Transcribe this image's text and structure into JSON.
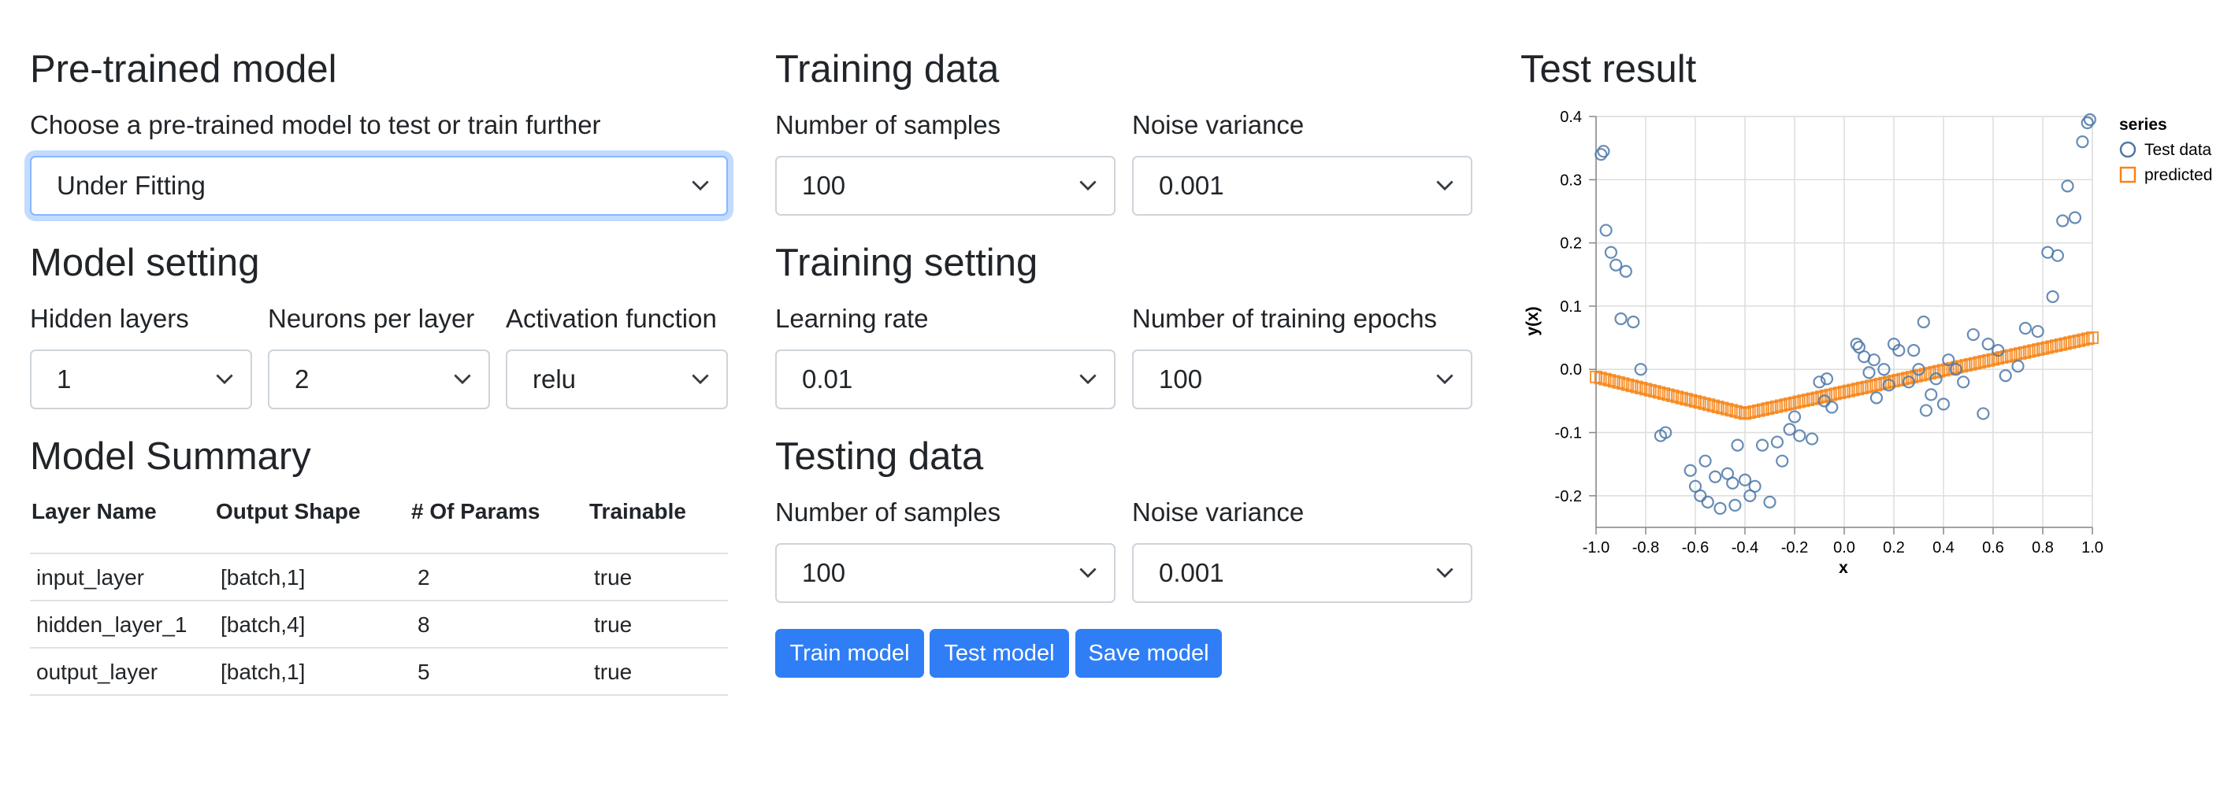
{
  "pretrained": {
    "title": "Pre-trained model",
    "description": "Choose a pre-trained model to test or train further",
    "selected": "Under Fitting"
  },
  "model_setting": {
    "title": "Model setting",
    "hidden_layers_label": "Hidden layers",
    "hidden_layers_value": "1",
    "neurons_label": "Neurons per layer",
    "neurons_value": "2",
    "activation_label": "Activation function",
    "activation_value": "relu"
  },
  "model_summary": {
    "title": "Model Summary",
    "columns": [
      "Layer Name",
      "Output Shape",
      "# Of Params",
      "Trainable"
    ],
    "rows": [
      [
        "input_layer",
        "[batch,1]",
        "2",
        "true"
      ],
      [
        "hidden_layer_1",
        "[batch,4]",
        "8",
        "true"
      ],
      [
        "output_layer",
        "[batch,1]",
        "5",
        "true"
      ]
    ]
  },
  "training_data": {
    "title": "Training data",
    "samples_label": "Number of samples",
    "samples_value": "100",
    "noise_label": "Noise variance",
    "noise_value": "0.001"
  },
  "training_setting": {
    "title": "Training setting",
    "lr_label": "Learning rate",
    "lr_value": "0.01",
    "epochs_label": "Number of training epochs",
    "epochs_value": "100"
  },
  "testing_data": {
    "title": "Testing data",
    "samples_label": "Number of samples",
    "samples_value": "100",
    "noise_label": "Noise variance",
    "noise_value": "0.001"
  },
  "buttons": {
    "train": "Train model",
    "test": "Test model",
    "save": "Save model"
  },
  "test_result": {
    "title": "Test result"
  },
  "chart_data": {
    "type": "scatter",
    "xlabel": "x",
    "ylabel": "y(x)",
    "xlim": [
      -1.0,
      1.0
    ],
    "ylim": [
      -0.25,
      0.4
    ],
    "xticks": [
      -1.0,
      -0.8,
      -0.6,
      -0.4,
      -0.2,
      0.0,
      0.2,
      0.4,
      0.6,
      0.8,
      1.0
    ],
    "xtick_labels": [
      "-1.0",
      "-0.8",
      "-0.6",
      "-0.4",
      "-0.2",
      "0.0",
      "0.2",
      "0.4",
      "0.6",
      "0.8",
      "1.0"
    ],
    "yticks": [
      -0.2,
      -0.1,
      0.0,
      0.1,
      0.2,
      0.3,
      0.4
    ],
    "ytick_labels": [
      "-0.2",
      "-0.1",
      "0.0",
      "0.1",
      "0.2",
      "0.3",
      "0.4"
    ],
    "grid": true,
    "legend_title": "series",
    "legend_position": "right",
    "series": [
      {
        "name": "Test data",
        "marker": "circle",
        "color": "#4c78a8",
        "points": [
          [
            -0.98,
            0.34
          ],
          [
            -0.97,
            0.345
          ],
          [
            -0.96,
            0.22
          ],
          [
            -0.94,
            0.185
          ],
          [
            -0.92,
            0.165
          ],
          [
            -0.88,
            0.155
          ],
          [
            -0.9,
            0.08
          ],
          [
            -0.85,
            0.075
          ],
          [
            -0.82,
            0.0
          ],
          [
            -0.74,
            -0.105
          ],
          [
            -0.72,
            -0.1
          ],
          [
            -0.62,
            -0.16
          ],
          [
            -0.6,
            -0.185
          ],
          [
            -0.58,
            -0.2
          ],
          [
            -0.56,
            -0.145
          ],
          [
            -0.55,
            -0.21
          ],
          [
            -0.52,
            -0.17
          ],
          [
            -0.5,
            -0.22
          ],
          [
            -0.47,
            -0.165
          ],
          [
            -0.45,
            -0.18
          ],
          [
            -0.44,
            -0.215
          ],
          [
            -0.43,
            -0.12
          ],
          [
            -0.4,
            -0.175
          ],
          [
            -0.38,
            -0.2
          ],
          [
            -0.36,
            -0.185
          ],
          [
            -0.33,
            -0.12
          ],
          [
            -0.3,
            -0.21
          ],
          [
            -0.27,
            -0.115
          ],
          [
            -0.25,
            -0.145
          ],
          [
            -0.22,
            -0.095
          ],
          [
            -0.2,
            -0.075
          ],
          [
            -0.18,
            -0.105
          ],
          [
            -0.13,
            -0.11
          ],
          [
            -0.1,
            -0.02
          ],
          [
            -0.08,
            -0.05
          ],
          [
            -0.07,
            -0.015
          ],
          [
            -0.05,
            -0.06
          ],
          [
            0.05,
            0.04
          ],
          [
            0.06,
            0.035
          ],
          [
            0.08,
            0.02
          ],
          [
            0.1,
            -0.005
          ],
          [
            0.12,
            0.015
          ],
          [
            0.13,
            -0.045
          ],
          [
            0.16,
            0.0
          ],
          [
            0.18,
            -0.025
          ],
          [
            0.2,
            0.04
          ],
          [
            0.22,
            0.03
          ],
          [
            0.26,
            -0.02
          ],
          [
            0.28,
            0.03
          ],
          [
            0.3,
            0.0
          ],
          [
            0.32,
            0.075
          ],
          [
            0.33,
            -0.065
          ],
          [
            0.35,
            -0.04
          ],
          [
            0.37,
            -0.015
          ],
          [
            0.4,
            -0.055
          ],
          [
            0.42,
            0.015
          ],
          [
            0.45,
            0.0
          ],
          [
            0.48,
            -0.02
          ],
          [
            0.52,
            0.055
          ],
          [
            0.56,
            -0.07
          ],
          [
            0.58,
            0.04
          ],
          [
            0.62,
            0.03
          ],
          [
            0.65,
            -0.01
          ],
          [
            0.7,
            0.005
          ],
          [
            0.73,
            0.065
          ],
          [
            0.78,
            0.06
          ],
          [
            0.82,
            0.185
          ],
          [
            0.84,
            0.115
          ],
          [
            0.86,
            0.18
          ],
          [
            0.88,
            0.235
          ],
          [
            0.9,
            0.29
          ],
          [
            0.93,
            0.24
          ],
          [
            0.96,
            0.36
          ],
          [
            0.98,
            0.39
          ],
          [
            0.99,
            0.395
          ]
        ]
      },
      {
        "name": "predicted",
        "marker": "square",
        "color": "#f58518",
        "line": [
          [
            -1.0,
            -0.012
          ],
          [
            -0.4,
            -0.07
          ],
          [
            1.0,
            0.05
          ]
        ]
      }
    ]
  }
}
